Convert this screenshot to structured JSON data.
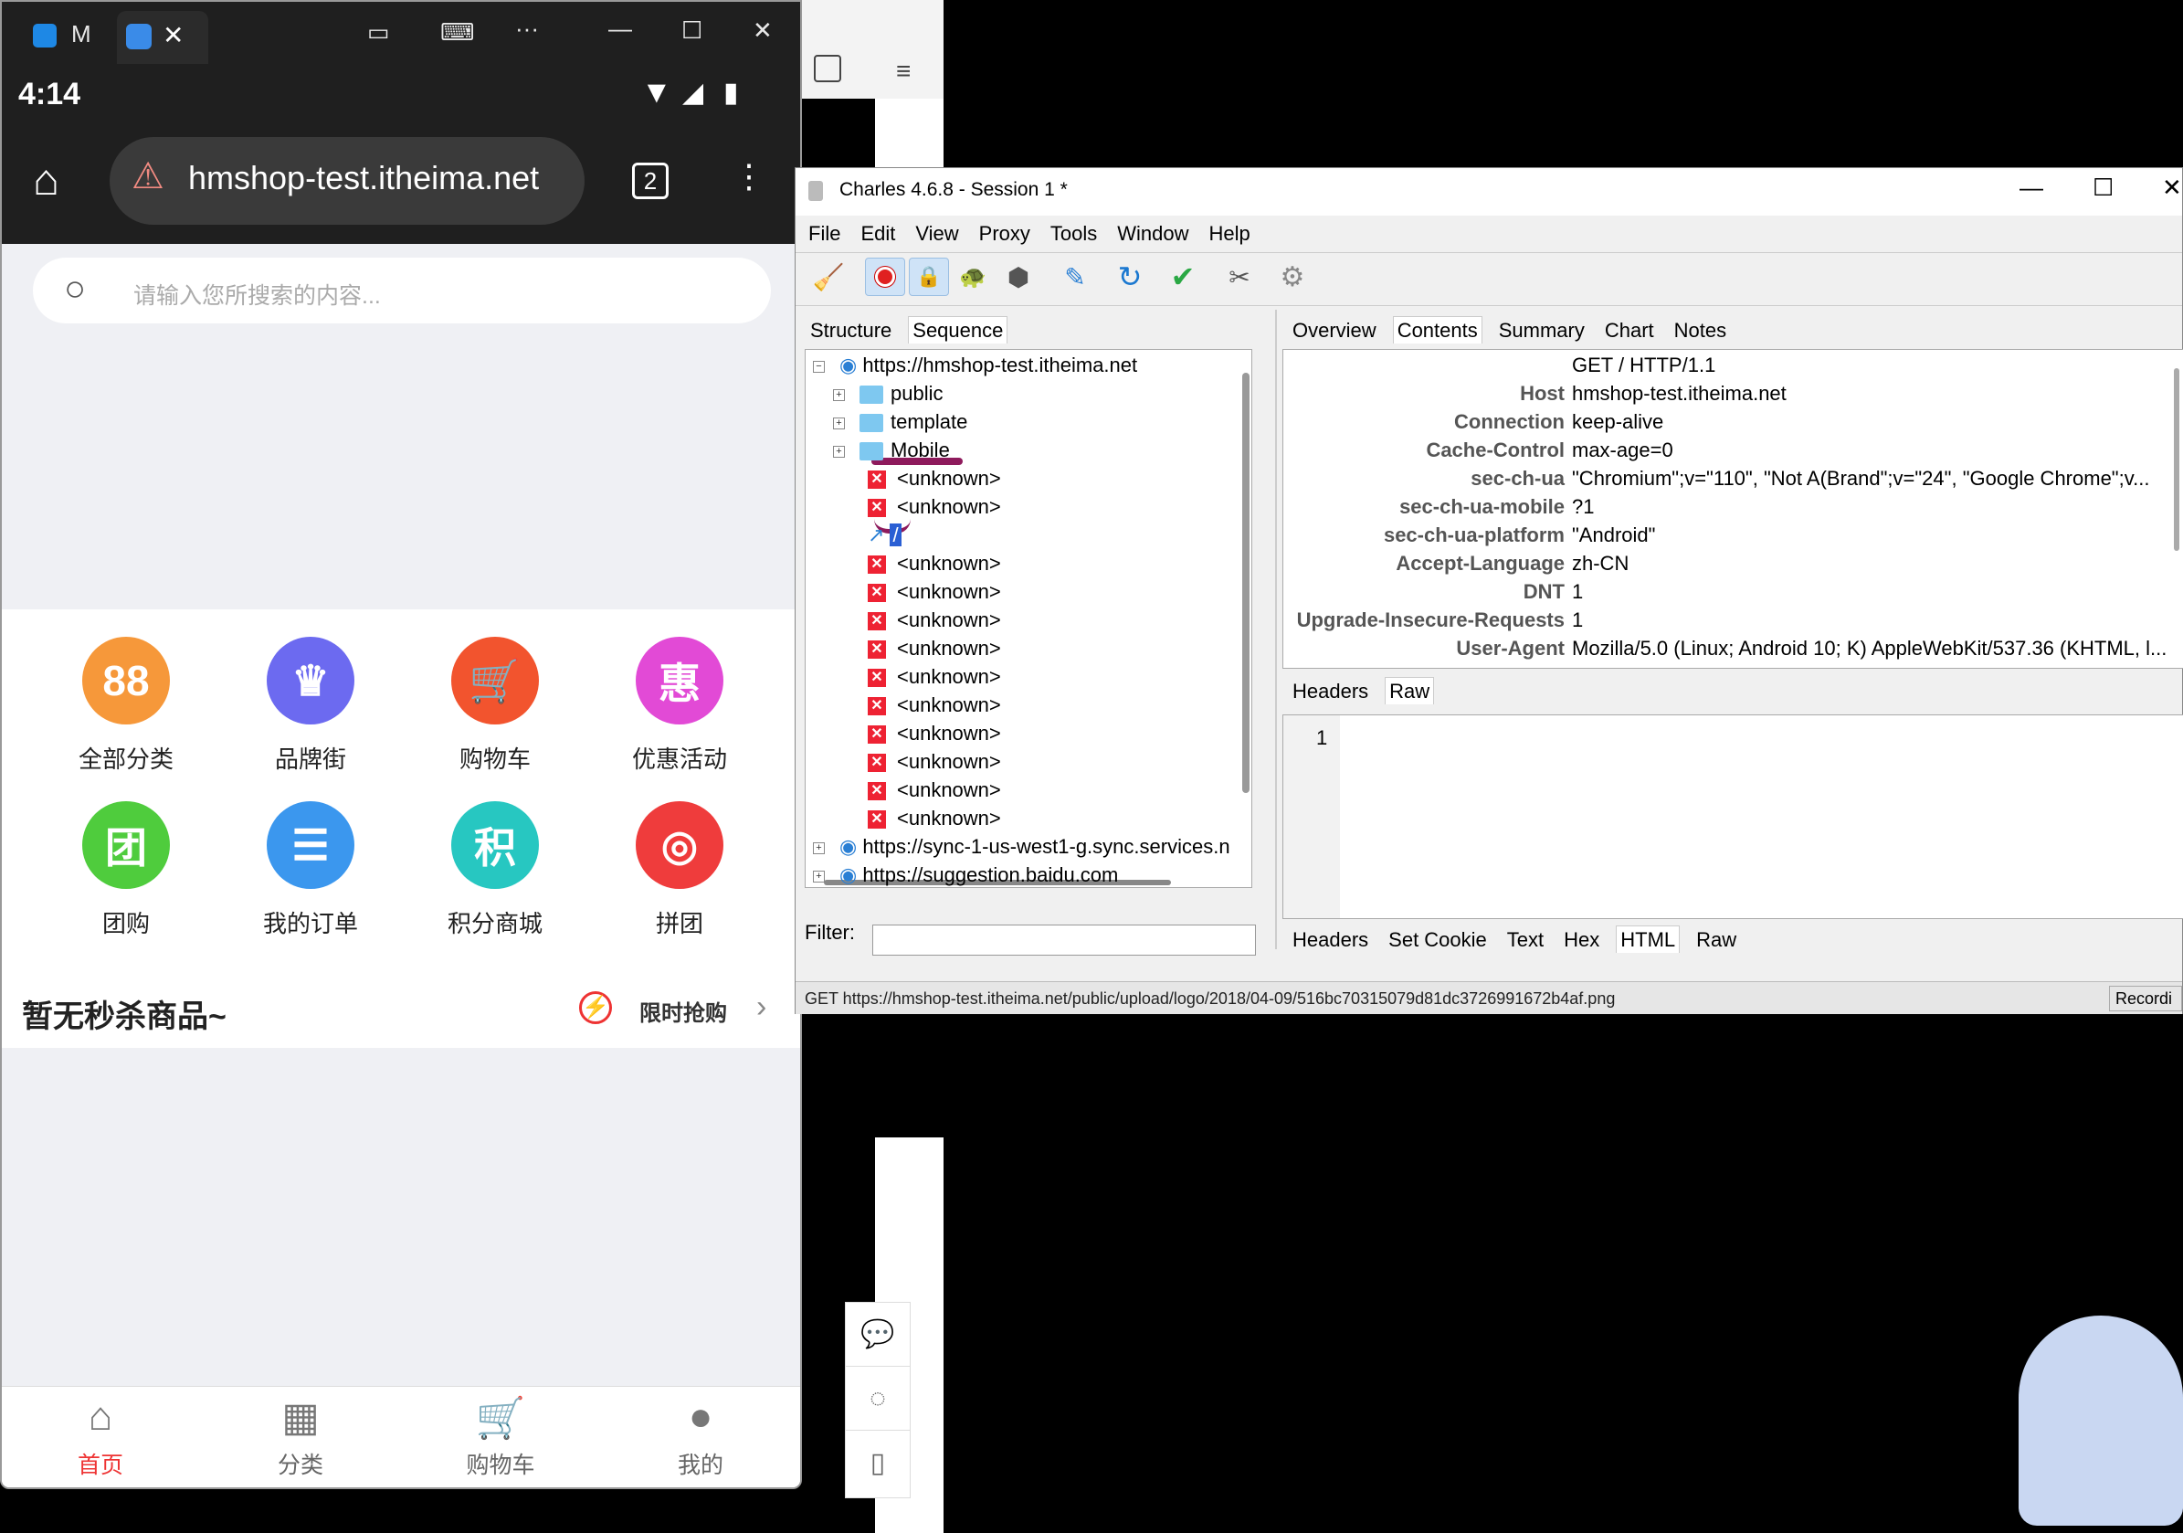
{
  "phone": {
    "tab_letter": "M",
    "time": "4:14",
    "tab_count": "2",
    "url": "hmshop-test.itheima.net",
    "search_placeholder": "请输入您所搜索的内容...",
    "categories": [
      {
        "label": "全部分类",
        "color": "#f6983a",
        "glyph": "88"
      },
      {
        "label": "品牌街",
        "color": "#6c6af0",
        "glyph": "♛"
      },
      {
        "label": "购物车",
        "color": "#f2542e",
        "glyph": "🛒"
      },
      {
        "label": "优惠活动",
        "color": "#e24ad6",
        "glyph": "惠"
      },
      {
        "label": "团购",
        "color": "#4fcc3d",
        "glyph": "团"
      },
      {
        "label": "我的订单",
        "color": "#3b97ee",
        "glyph": "☰"
      },
      {
        "label": "积分商城",
        "color": "#27c7c1",
        "glyph": "积"
      },
      {
        "label": "拼团",
        "color": "#ef3c3c",
        "glyph": "◎"
      }
    ],
    "flash_title": "暂无秒杀商品~",
    "flash_link": "限时抢购",
    "bottom_nav": [
      {
        "label": "首页",
        "active": true
      },
      {
        "label": "分类",
        "active": false
      },
      {
        "label": "购物车",
        "active": false
      },
      {
        "label": "我的",
        "active": false
      }
    ]
  },
  "charles": {
    "title": "Charles 4.6.8 - Session 1 *",
    "menu": [
      "File",
      "Edit",
      "View",
      "Proxy",
      "Tools",
      "Window",
      "Help"
    ],
    "left_tabs": [
      "Structure",
      "Sequence"
    ],
    "right_tabs": [
      "Overview",
      "Contents",
      "Summary",
      "Chart",
      "Notes"
    ],
    "tree": {
      "root": "https://hmshop-test.itheima.net",
      "folders": [
        "public",
        "template",
        "Mobile"
      ],
      "unknown": "<unknown>",
      "slash": "/",
      "other_hosts": [
        "https://sync-1-us-west1-g.sync.services.n",
        "https://suggestion.baidu.com"
      ]
    },
    "request_line": "GET / HTTP/1.1",
    "headers": [
      {
        "k": "Host",
        "v": "hmshop-test.itheima.net"
      },
      {
        "k": "Connection",
        "v": "keep-alive"
      },
      {
        "k": "Cache-Control",
        "v": "max-age=0"
      },
      {
        "k": "sec-ch-ua",
        "v": "\"Chromium\";v=\"110\", \"Not A(Brand\";v=\"24\", \"Google Chrome\";v..."
      },
      {
        "k": "sec-ch-ua-mobile",
        "v": "?1"
      },
      {
        "k": "sec-ch-ua-platform",
        "v": "\"Android\""
      },
      {
        "k": "Accept-Language",
        "v": "zh-CN"
      },
      {
        "k": "DNT",
        "v": "1"
      },
      {
        "k": "Upgrade-Insecure-Requests",
        "v": "1"
      },
      {
        "k": "User-Agent",
        "v": "Mozilla/5.0 (Linux; Android 10; K) AppleWebKit/537.36 (KHTML, l..."
      }
    ],
    "req_tabs": [
      "Headers",
      "Raw"
    ],
    "resp_line_no": "1",
    "resp_tabs": [
      "Headers",
      "Set Cookie",
      "Text",
      "Hex",
      "HTML",
      "Raw"
    ],
    "filter_label": "Filter:",
    "status_text": "GET https://hmshop-test.itheima.net/public/upload/logo/2018/04-09/516bc70315079d81dc3726991672b4af.png",
    "status_right": "Recordi"
  }
}
